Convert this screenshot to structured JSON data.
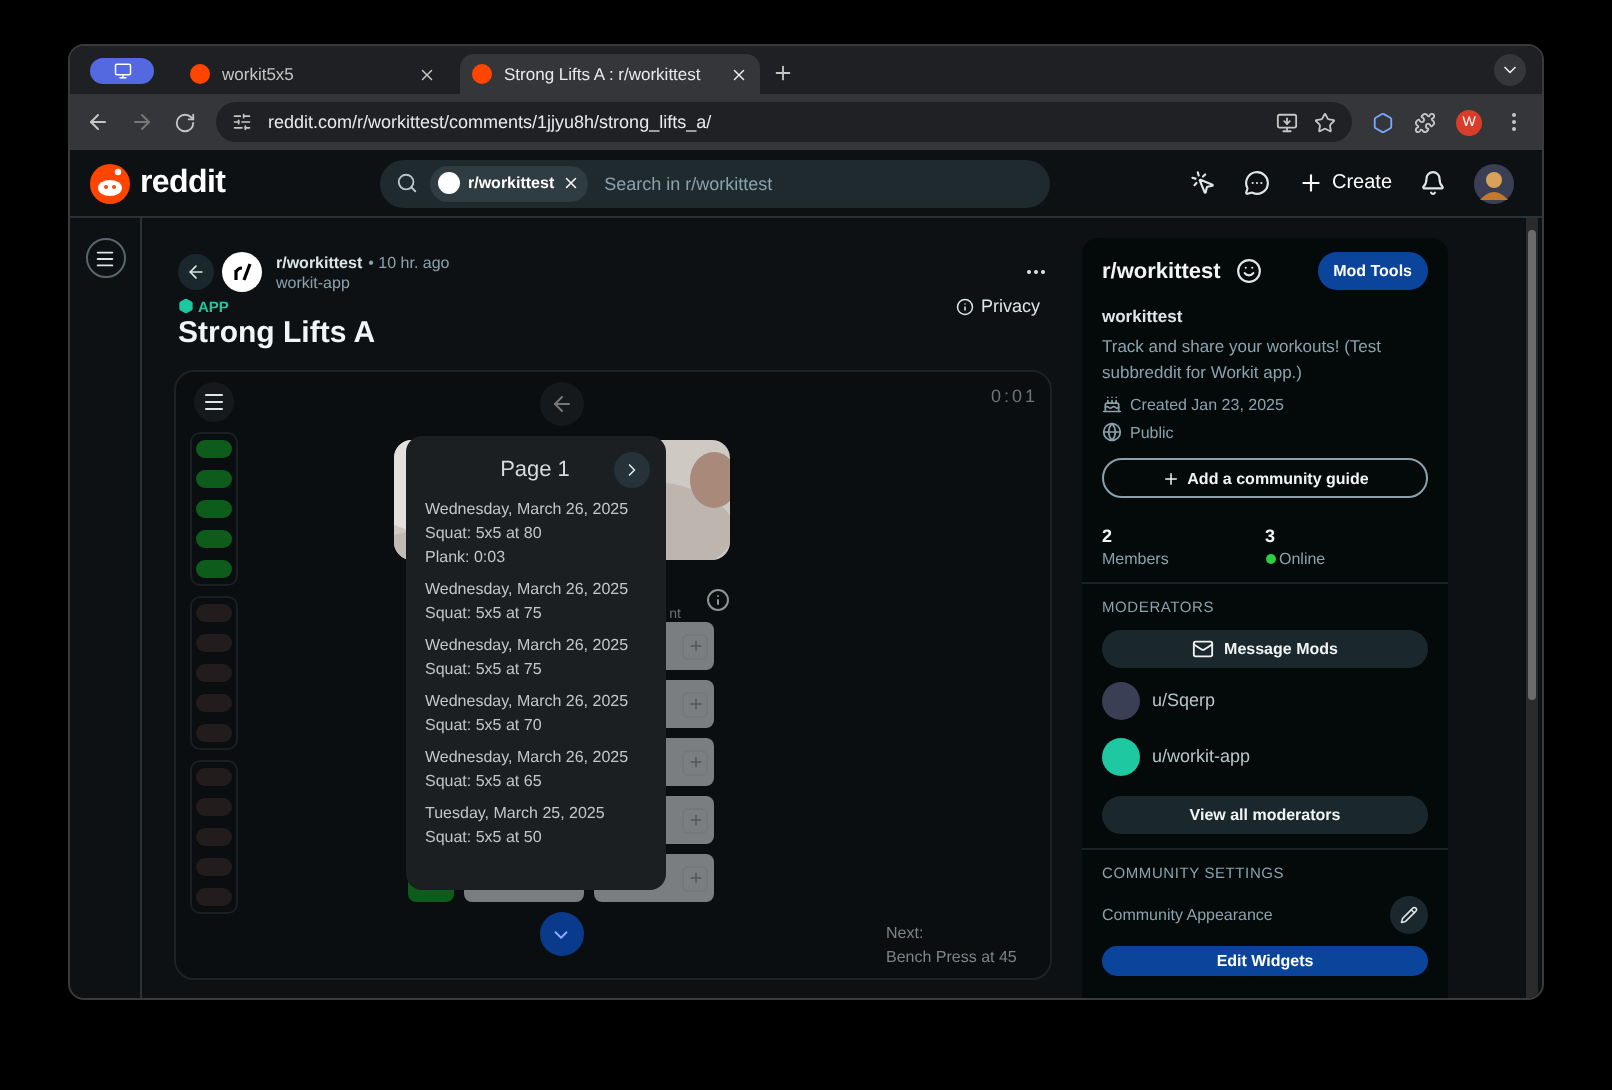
{
  "browser": {
    "tabs": [
      {
        "title": "workit5x5",
        "selected": false
      },
      {
        "title": "Strong Lifts A : r/workittest",
        "selected": true
      }
    ],
    "url": "reddit.com/r/workittest/comments/1jjyu8h/strong_lifts_a/",
    "profile_initial": "W"
  },
  "header": {
    "logo": "reddit",
    "search_chip": "r/workittest",
    "search_placeholder": "Search in r/workittest",
    "create": "Create"
  },
  "post": {
    "subreddit": "r/workittest",
    "age": "• 10 hr. ago",
    "author": "workit-app",
    "badge": "APP",
    "privacy": "Privacy",
    "title": "Strong Lifts A"
  },
  "app": {
    "timer": "0:01",
    "progress_groups": [
      {
        "sets": [
          {
            "done": true
          },
          {
            "done": true
          },
          {
            "done": true
          },
          {
            "done": true
          },
          {
            "done": true
          }
        ]
      },
      {
        "sets": [
          {
            "done": false
          },
          {
            "done": false
          },
          {
            "done": false
          },
          {
            "done": false
          },
          {
            "done": false
          }
        ]
      },
      {
        "sets": [
          {
            "done": false
          },
          {
            "done": false
          },
          {
            "done": false
          },
          {
            "done": false
          },
          {
            "done": false
          }
        ]
      }
    ],
    "hidden_label": "nt",
    "popup": {
      "title": "Page 1",
      "entries": [
        {
          "lines": [
            "Wednesday, March 26, 2025",
            "Squat: 5x5 at 80",
            "Plank: 0:03"
          ]
        },
        {
          "lines": [
            "Wednesday, March 26, 2025",
            "Squat: 5x5 at 75"
          ]
        },
        {
          "lines": [
            "Wednesday, March 26, 2025",
            "Squat: 5x5 at 75"
          ]
        },
        {
          "lines": [
            "Wednesday, March 26, 2025",
            "Squat: 5x5 at 70"
          ]
        },
        {
          "lines": [
            "Wednesday, March 26, 2025",
            "Squat: 5x5 at 65"
          ]
        },
        {
          "lines": [
            "Tuesday, March 25, 2025",
            "Squat: 5x5 at 50"
          ]
        }
      ]
    },
    "next_label": "Next:",
    "next_value": "Bench Press at 45"
  },
  "sidebar": {
    "community": "r/workittest",
    "mod_tools": "Mod Tools",
    "name": "workittest",
    "description": "Track and share your workouts! (Test subbreddit for Workit app.)",
    "created": "Created Jan 23, 2025",
    "visibility": "Public",
    "add_guide": "Add a community guide",
    "stats": [
      {
        "value": "2",
        "label": "Members",
        "online": false
      },
      {
        "value": "3",
        "label": "Online",
        "online": true
      }
    ],
    "moderators_heading": "MODERATORS",
    "message_mods": "Message Mods",
    "moderators": [
      {
        "name": "u/Sqerp",
        "color": "#3a3f55"
      },
      {
        "name": "u/workit-app",
        "color": "#1ec8a0"
      }
    ],
    "view_all": "View all moderators",
    "settings_heading": "COMMUNITY SETTINGS",
    "appearance": "Community Appearance",
    "edit_widgets": "Edit Widgets"
  }
}
